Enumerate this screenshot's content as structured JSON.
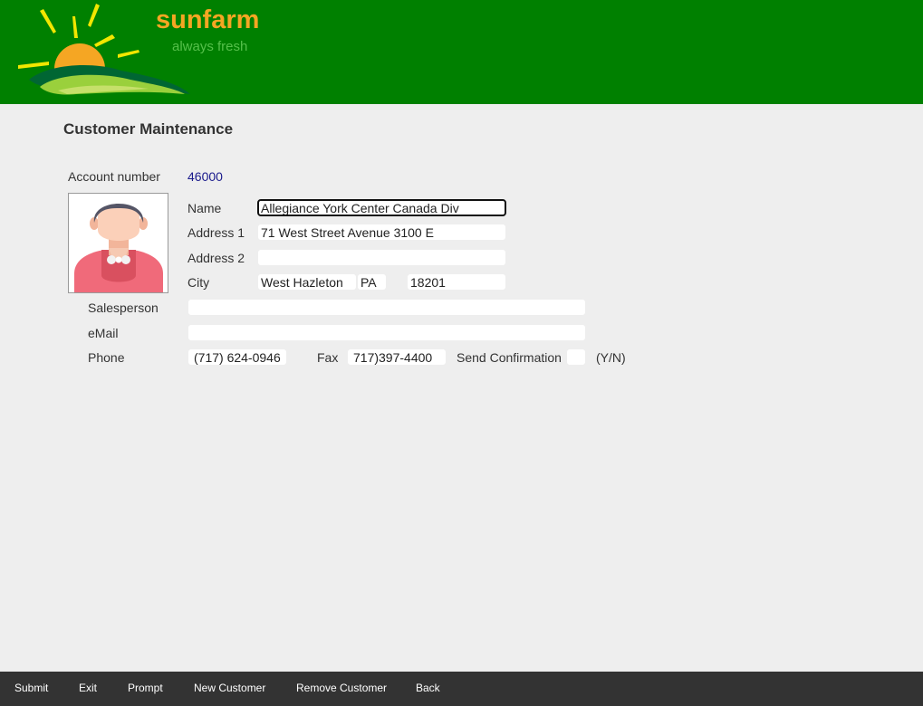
{
  "header": {
    "brand": "sunfarm",
    "tagline": "always fresh",
    "colors": {
      "background": "#008000",
      "brand": "#f5a623",
      "tagline": "#55c04a"
    }
  },
  "page": {
    "title": "Customer Maintenance"
  },
  "form": {
    "account_number": {
      "label": "Account number",
      "value": "46000"
    },
    "name": {
      "label": "Name",
      "value": "Allegiance York Center Canada Div"
    },
    "address1": {
      "label": "Address 1",
      "value": "71 West Street Avenue 3100 E"
    },
    "address2": {
      "label": "Address 2",
      "value": ""
    },
    "city": {
      "label": "City",
      "value": "West Hazleton",
      "state": "PA",
      "zip": "18201"
    },
    "salesperson": {
      "label": "Salesperson",
      "value": ""
    },
    "email": {
      "label": "eMail",
      "value": ""
    },
    "phone": {
      "label": "Phone",
      "value": "(717) 624-0946"
    },
    "fax": {
      "label": "Fax",
      "value": "717)397-4400"
    },
    "send_confirmation": {
      "label": "Send Confirmation",
      "value": "",
      "hint": "(Y/N)"
    }
  },
  "footer": {
    "keys": [
      "Submit",
      "Exit",
      "Prompt",
      "New Customer",
      "Remove Customer",
      "Back"
    ]
  },
  "icons": {
    "photo": "customer-avatar-icon",
    "logo": "sun-logo-icon"
  }
}
